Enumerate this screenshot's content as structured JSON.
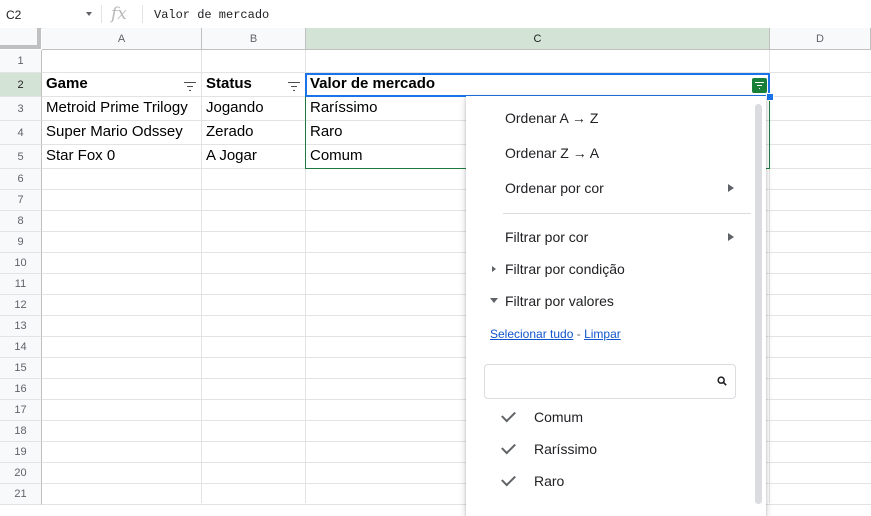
{
  "formula_bar": {
    "name_box": "C2",
    "fx": "fx",
    "value": "Valor de mercado"
  },
  "columns": [
    "A",
    "B",
    "C",
    "D"
  ],
  "rows": [
    "1",
    "2",
    "3",
    "4",
    "5",
    "6",
    "7",
    "8",
    "9",
    "10",
    "11",
    "12",
    "13",
    "14",
    "15",
    "16",
    "17",
    "18",
    "19",
    "20",
    "21"
  ],
  "sheet": {
    "header": [
      "Game",
      "Status",
      "Valor de mercado"
    ],
    "data": [
      [
        "Metroid Prime Trilogy",
        "Jogando",
        "Raríssimo"
      ],
      [
        "Super Mario Odssey",
        "Zerado",
        "Raro"
      ],
      [
        "Star Fox 0",
        "A Jogar",
        "Comum"
      ]
    ]
  },
  "filter_menu": {
    "sort_az": "Ordenar A → Z",
    "sort_za": "Ordenar Z → A",
    "sort_color": "Ordenar por cor",
    "filter_color": "Filtrar por cor",
    "filter_condition": "Filtrar por condição",
    "filter_values": "Filtrar por valores",
    "select_all": "Selecionar tudo",
    "separator": " - ",
    "clear": "Limpar",
    "search_placeholder": "",
    "values": [
      {
        "label": "Comum",
        "checked": true
      },
      {
        "label": "Raríssimo",
        "checked": true
      },
      {
        "label": "Raro",
        "checked": true
      }
    ]
  },
  "colors": {
    "selection_border": "#1f7a3f",
    "active_border": "#1a73e8",
    "filter_button": "#188038",
    "selected_header": "#d3e3d6",
    "link": "#1155cc"
  }
}
